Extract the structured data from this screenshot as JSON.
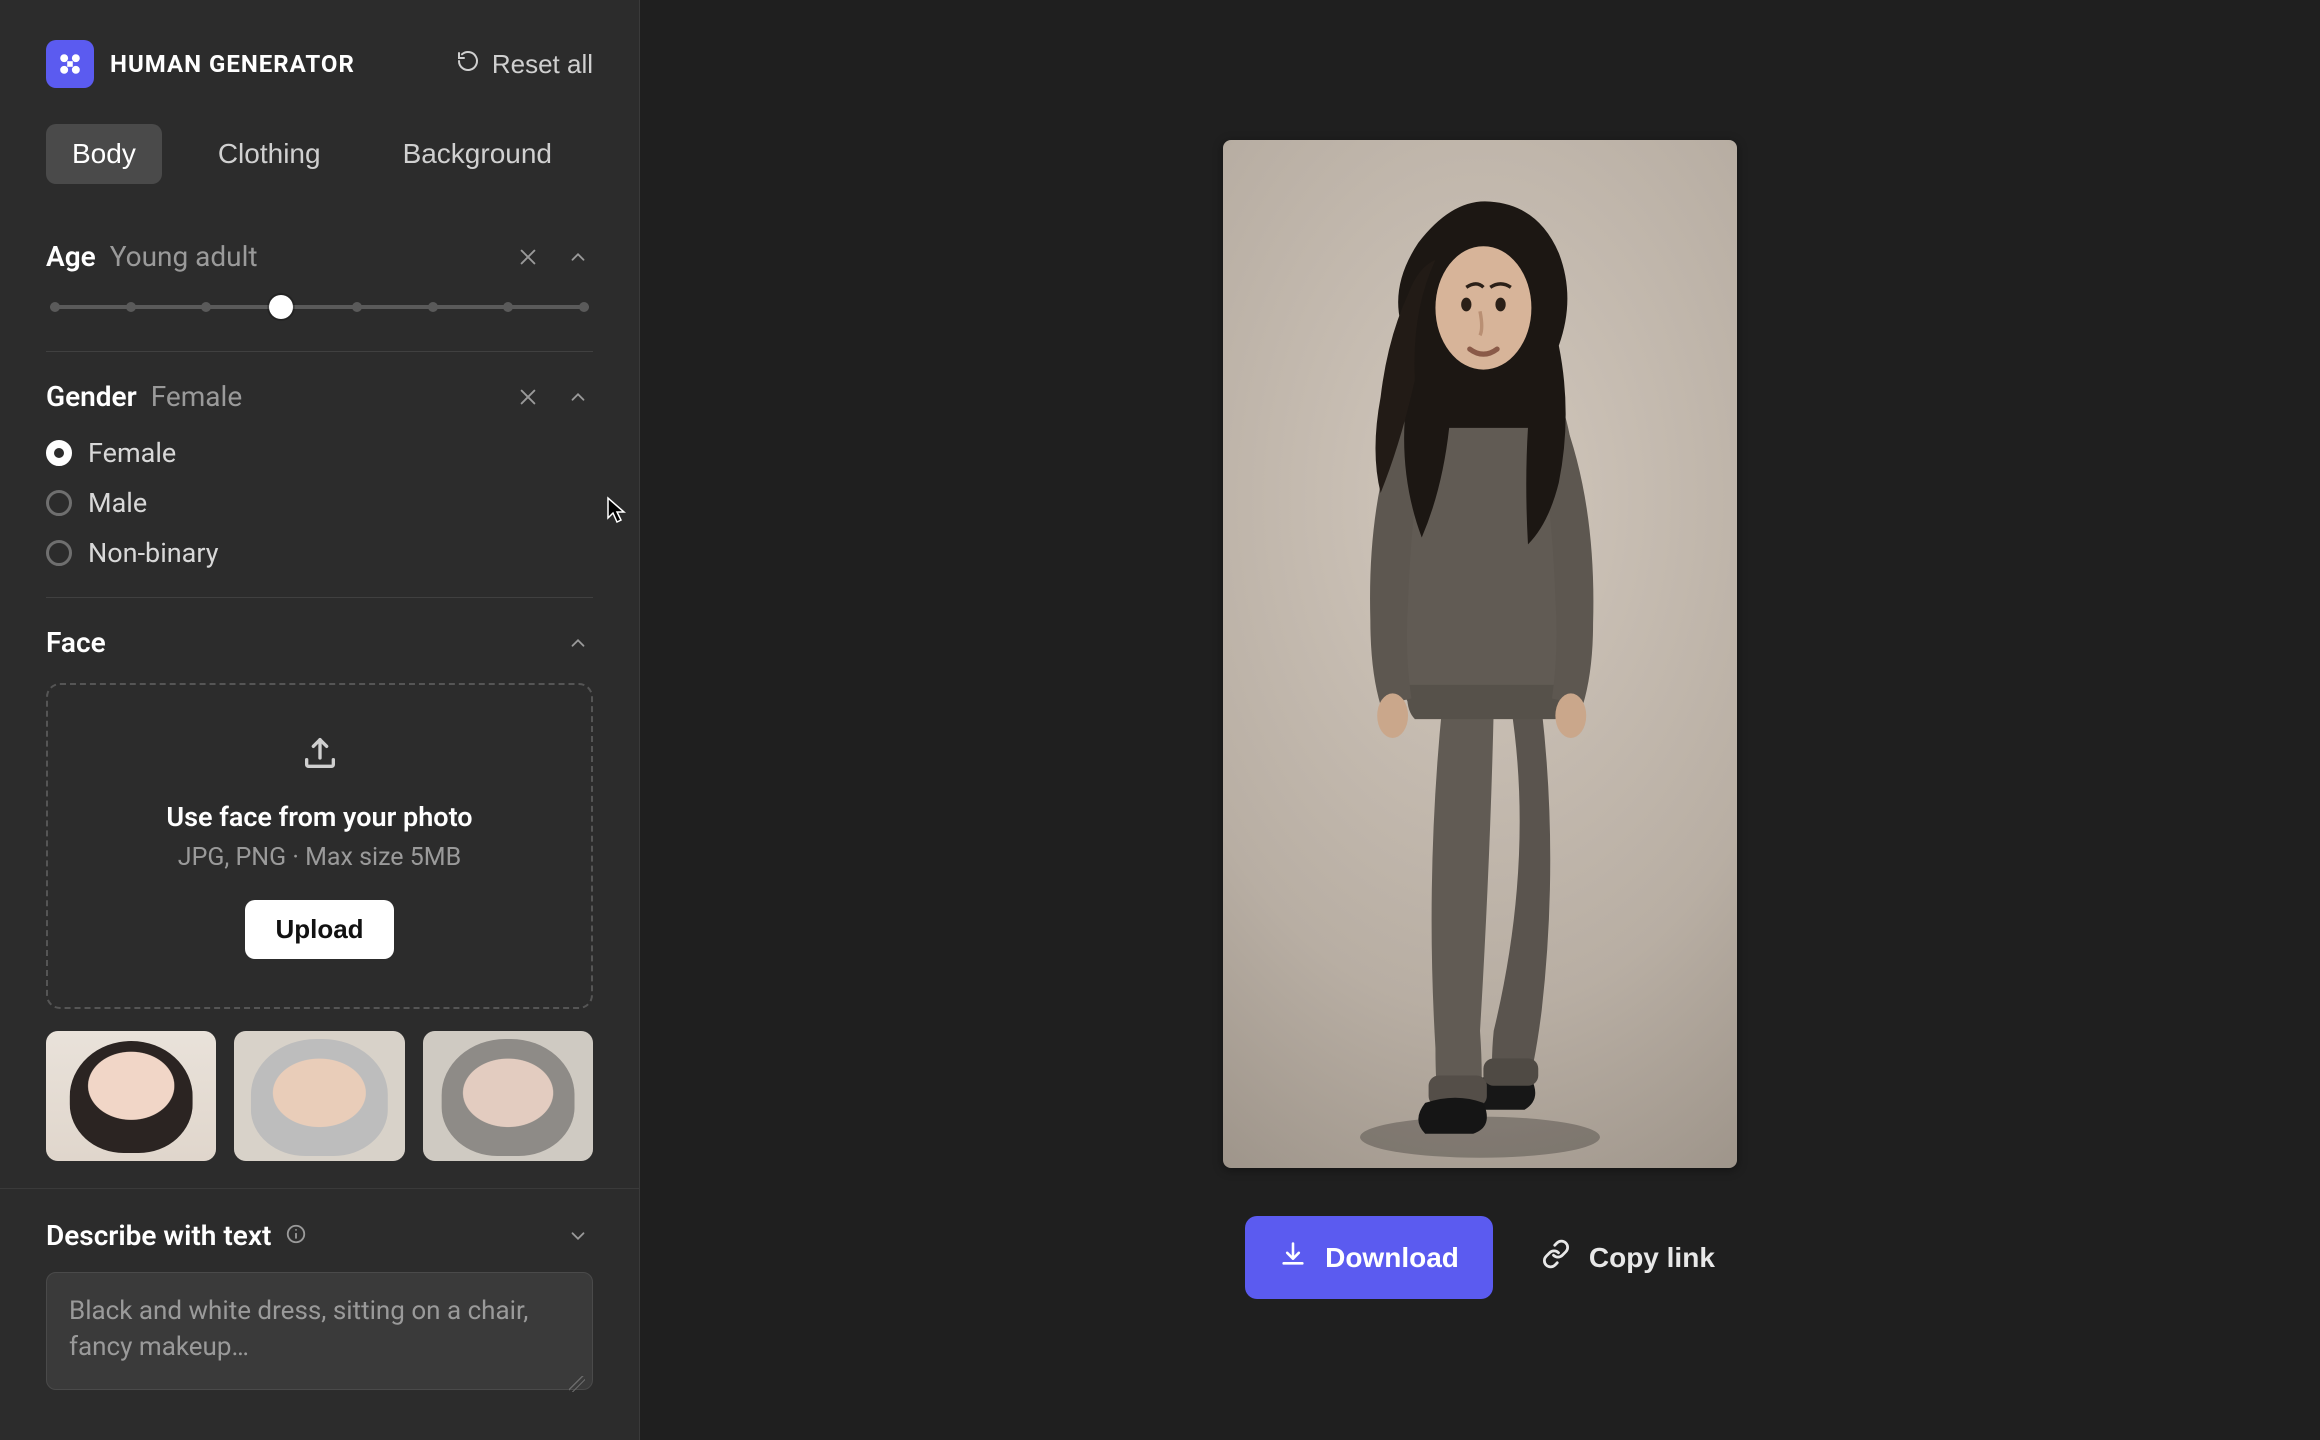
{
  "brand": {
    "name": "HUMAN GENERATOR"
  },
  "reset": {
    "label": "Reset all"
  },
  "tabs": [
    {
      "label": "Body",
      "active": true
    },
    {
      "label": "Clothing",
      "active": false
    },
    {
      "label": "Background",
      "active": false
    }
  ],
  "age": {
    "title": "Age",
    "value": "Young adult",
    "steps": 8,
    "index": 3
  },
  "gender": {
    "title": "Gender",
    "value": "Female",
    "options": [
      "Female",
      "Male",
      "Non-binary"
    ],
    "selected": "Female"
  },
  "face": {
    "title": "Face",
    "upload_title": "Use face from your photo",
    "upload_hint": "JPG, PNG · Max size 5MB",
    "upload_button": "Upload"
  },
  "describe": {
    "title": "Describe with text",
    "placeholder": "Black and white dress, sitting on a chair, fancy makeup…"
  },
  "actions": {
    "download": "Download",
    "copy_link": "Copy link"
  },
  "colors": {
    "accent": "#5b5bf0",
    "panel": "#2c2c2c",
    "canvas": "#1f1f1f"
  }
}
